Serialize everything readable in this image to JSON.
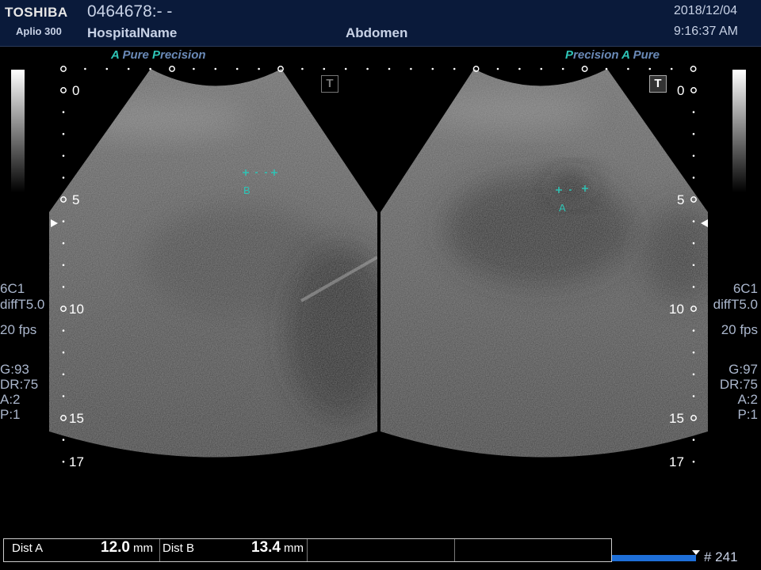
{
  "header": {
    "brand": "TOSHIBA",
    "model": "Aplio 300",
    "patient_id": "0464678:- -",
    "hospital": "HospitalName",
    "exam": "Abdomen",
    "date": "2018/12/04",
    "time": "9:16:37 AM"
  },
  "left_image": {
    "mode_a": "A",
    "mode_pure": "Pure",
    "mode_p": "P",
    "mode_precision": "recision",
    "depth_marks": [
      "0",
      "5",
      "10",
      "15",
      "17"
    ],
    "caliper_label": "B",
    "params": {
      "probe": "6C1",
      "harmonic": "diffT5.0",
      "fps": "20 fps",
      "gain": "G:93",
      "dr": "DR:75",
      "a": "A:2",
      "p": "P:1"
    },
    "t_icon": "T"
  },
  "right_image": {
    "mode_p": "P",
    "mode_precision": "recision",
    "mode_a": "A",
    "mode_pure": "Pure",
    "depth_marks": [
      "0",
      "5",
      "10",
      "15",
      "17"
    ],
    "caliper_label": "A",
    "params": {
      "probe": "6C1",
      "harmonic": "diffT5.0",
      "fps": "20 fps",
      "gain": "G:97",
      "dr": "DR:75",
      "a": "A:2",
      "p": "P:1"
    },
    "t_icon": "T"
  },
  "measurements": [
    {
      "label": "Dist A",
      "value": "12.0",
      "unit": "mm"
    },
    {
      "label": "Dist B",
      "value": "13.4",
      "unit": "mm"
    }
  ],
  "cine": {
    "frame": "# 241",
    "progress": 1.0
  },
  "colors": {
    "header_bg": "#0a1a3a",
    "caliper": "#2ec4b6",
    "progress": "#1e6fd8"
  },
  "icons": {
    "t_icon": "text-T-box-icon",
    "focus_marker": "triangle-pointer-icon",
    "frame_marker": "triangle-down-icon"
  }
}
